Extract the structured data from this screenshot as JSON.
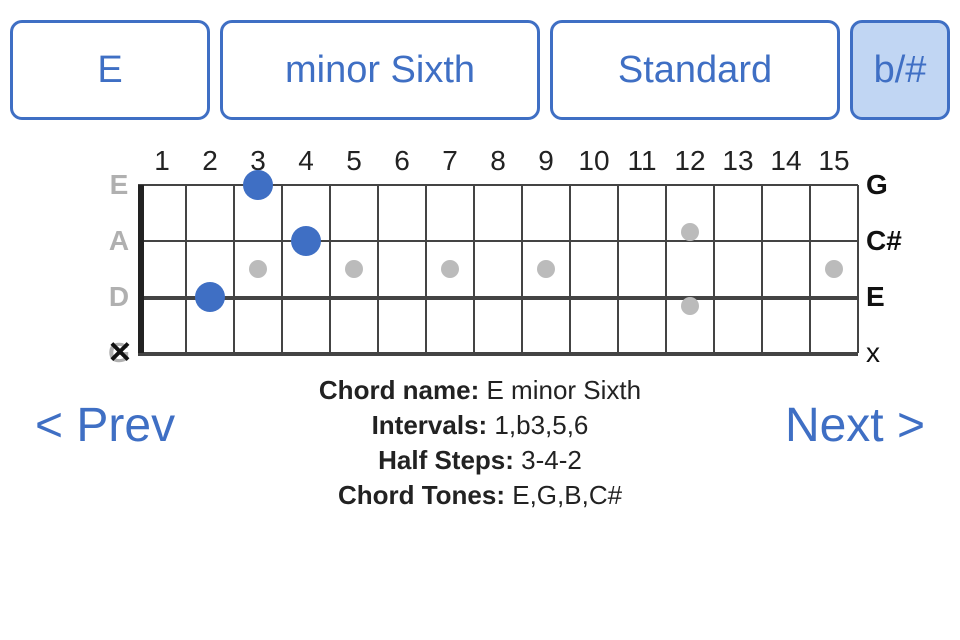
{
  "controls": {
    "root": "E",
    "chord_type": "minor Sixth",
    "tuning": "Standard",
    "accidental": "b/#"
  },
  "fretboard": {
    "num_frets": 15,
    "fret_labels": [
      "1",
      "2",
      "3",
      "4",
      "5",
      "6",
      "7",
      "8",
      "9",
      "10",
      "11",
      "12",
      "13",
      "14",
      "15"
    ],
    "strings": [
      {
        "open": "E",
        "result": "G",
        "fret": 3
      },
      {
        "open": "A",
        "result": "C#",
        "fret": 4
      },
      {
        "open": "D",
        "result": "E",
        "fret": 2
      },
      {
        "open": "G",
        "result": "x",
        "fret": null,
        "muted": true
      }
    ],
    "inlays_single": [
      3,
      5,
      7,
      9,
      15
    ],
    "inlays_double": [
      12
    ]
  },
  "info": {
    "name_label": "Chord name:",
    "name_value": "E minor Sixth",
    "intervals_label": "Intervals:",
    "intervals_value": "1,b3,5,6",
    "halfsteps_label": "Half Steps:",
    "halfsteps_value": "3-4-2",
    "tones_label": "Chord Tones:",
    "tones_value": "E,G,B,C#"
  },
  "nav": {
    "prev": "< Prev",
    "next": "Next >"
  }
}
